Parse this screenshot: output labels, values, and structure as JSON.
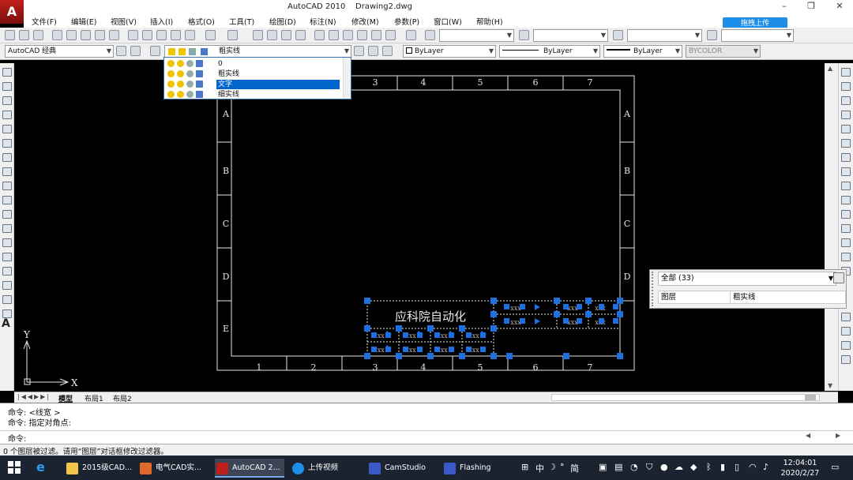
{
  "window": {
    "app_title": "AutoCAD 2010",
    "doc_title": "Drawing2.dwg",
    "minimize": "–",
    "restore": "❐",
    "close": "✕"
  },
  "logo": "A",
  "menu": [
    "文件(F)",
    "编辑(E)",
    "视图(V)",
    "插入(I)",
    "格式(O)",
    "工具(T)",
    "绘图(D)",
    "标注(N)",
    "修改(M)",
    "参数(P)",
    "窗口(W)",
    "帮助(H)"
  ],
  "upload_button": "拖拽上传",
  "toolbar2": {
    "workspace": "AutoCAD 经典",
    "layer_current": "粗实线",
    "color": "ByLayer",
    "linetype": "ByLayer",
    "lineweight": "ByLayer",
    "plotstyle": "BYCOLOR"
  },
  "layer_dropdown": {
    "items": [
      {
        "name": "0",
        "selected": false
      },
      {
        "name": "粗实线",
        "selected": false
      },
      {
        "name": "文字",
        "selected": true
      },
      {
        "name": "细实线",
        "selected": false
      }
    ]
  },
  "drawing": {
    "col_labels": [
      "3",
      "4",
      "5",
      "6",
      "7"
    ],
    "bottom_col_labels": [
      "1",
      "2",
      "3",
      "4",
      "5",
      "6",
      "7"
    ],
    "row_labels": [
      "A",
      "B",
      "C",
      "D",
      "E"
    ],
    "title_text": "应科院自动化",
    "small_text": "xxx",
    "axis_x": "X",
    "axis_y": "Y"
  },
  "tabs": {
    "model": "模型",
    "layout1": "布局1",
    "layout2": "布局2"
  },
  "properties": {
    "selection": "全部 (33)",
    "prop_key": "图层",
    "prop_value": "粗实线"
  },
  "command": {
    "line1": "命令:  <线宽 >",
    "line2": "命令: 指定对角点:",
    "line3": "命令:"
  },
  "status_text": "0 个图层被过滤。请用“图层”对话框修改过滤器。",
  "taskbar": {
    "items": [
      "2015级CAD...",
      "电气CAD实...",
      "AutoCAD 2...",
      "上传视频",
      "CamStudio",
      "Flashing"
    ],
    "ime": "中",
    "ime2": "简",
    "time": "12:04:01",
    "date": "2020/2/27"
  },
  "colors": {
    "accent": "#0066cc",
    "grip": "#1e6fe0",
    "taskbar": "#1c2330",
    "upload": "#1e8fe8"
  }
}
